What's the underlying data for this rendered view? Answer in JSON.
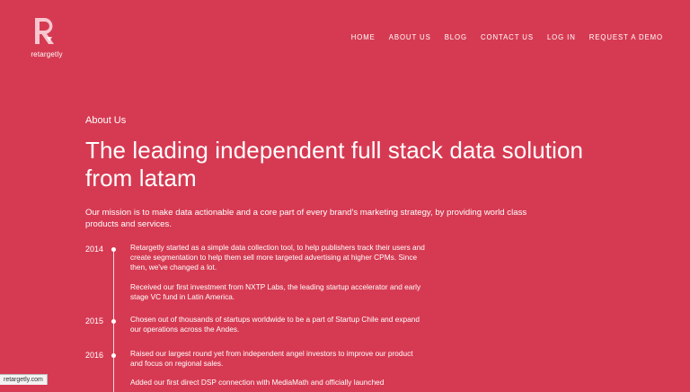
{
  "logo": {
    "text": "retargetly",
    "icon": "retargetly-logo-icon"
  },
  "nav": [
    {
      "label": "HOME"
    },
    {
      "label": "ABOUT US"
    },
    {
      "label": "BLOG"
    },
    {
      "label": "CONTACT US"
    },
    {
      "label": "LOG IN"
    },
    {
      "label": "REQUEST A DEMO"
    }
  ],
  "main": {
    "eyebrow": "About Us",
    "title": "The leading independent full stack data solution from latam",
    "mission": "Our mission is to make data actionable and a core part of every brand's marketing strategy, by providing world class products and services."
  },
  "timeline": [
    {
      "year": "2014",
      "entries": [
        "Retargetly started as a simple data collection tool, to help publishers track their users and create segmentation to help them sell more targeted advertising at higher CPMs. Since then, we've changed a lot.",
        "Received our first investment from NXTP Labs, the leading startup accelerator and early stage VC fund in Latin America."
      ]
    },
    {
      "year": "2015",
      "entries": [
        "Chosen out of thousands of startups worldwide to be a part of Startup Chile and expand our operations across the Andes."
      ]
    },
    {
      "year": "2016",
      "entries": [
        "Raised our largest round yet from independent angel investors to improve our product and focus on regional sales.",
        "Added our first direct DSP connection with MediaMath and officially launched"
      ]
    }
  ],
  "status_bar": {
    "text": "retargetly.com"
  },
  "colors": {
    "background": "#d63a52",
    "logo_pink": "#f7c6cf"
  }
}
